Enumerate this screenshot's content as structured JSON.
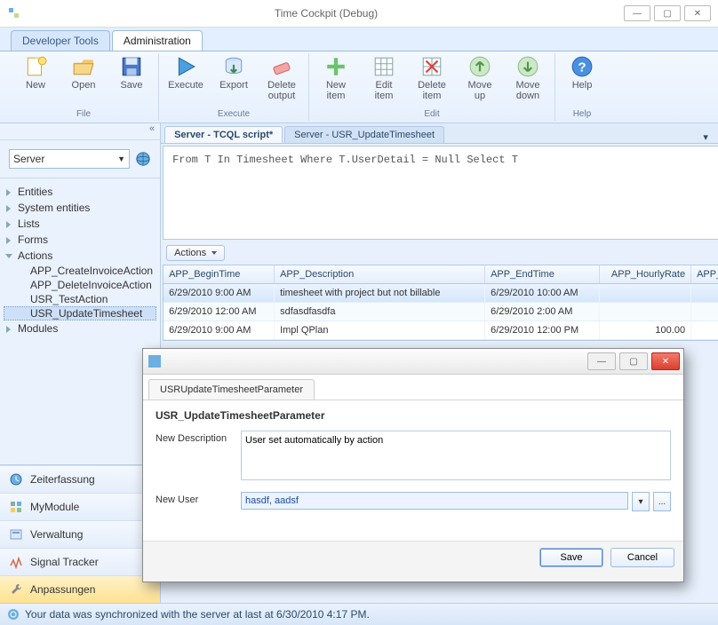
{
  "window": {
    "title": "Time Cockpit (Debug)"
  },
  "top_tabs": {
    "dev": "Developer Tools",
    "admin": "Administration"
  },
  "ribbon": {
    "file": {
      "label": "File",
      "new": "New",
      "open": "Open",
      "save": "Save"
    },
    "execute": {
      "label": "Execute",
      "execute": "Execute",
      "export": "Export",
      "delete_output": "Delete\noutput"
    },
    "edit": {
      "label": "Edit",
      "new_item": "New\nitem",
      "edit_item": "Edit\nitem",
      "delete_item": "Delete\nitem",
      "move_up": "Move\nup",
      "move_down": "Move\ndown"
    },
    "help": {
      "label": "Help",
      "help": "Help"
    }
  },
  "sidebar": {
    "collapse": "«",
    "dropdown": "Server",
    "tree": {
      "entities": "Entities",
      "system_entities": "System entities",
      "lists": "Lists",
      "forms": "Forms",
      "actions": "Actions",
      "actions_children": {
        "c0": "APP_CreateInvoiceAction",
        "c1": "APP_DeleteInvoiceAction",
        "c2": "USR_TestAction",
        "c3": "USR_UpdateTimesheet"
      },
      "modules": "Modules"
    },
    "nav": {
      "n0": "Zeiterfassung",
      "n1": "MyModule",
      "n2": "Verwaltung",
      "n3": "Signal Tracker",
      "n4": "Anpassungen"
    }
  },
  "doctabs": {
    "t0": "Server - TCQL script*",
    "t1": "Server - USR_UpdateTimesheet"
  },
  "editor": {
    "text": "From T In Timesheet Where T.UserDetail = Null Select T"
  },
  "actions_dropdown": "Actions",
  "grid": {
    "headers": {
      "h0": "APP_BeginTime",
      "h1": "APP_Description",
      "h2": "APP_EndTime",
      "h3": "APP_HourlyRate",
      "h4": "APP_H"
    },
    "rows": {
      "r0": {
        "c0": "6/29/2010 9:00 AM",
        "c1": "timesheet with project but not billable",
        "c2": "6/29/2010 10:00 AM",
        "c3": "",
        "c4": ""
      },
      "r1": {
        "c0": "6/29/2010 12:00 AM",
        "c1": "sdfasdfasdfa",
        "c2": "6/29/2010 2:00 AM",
        "c3": "",
        "c4": ""
      },
      "r2": {
        "c0": "6/29/2010 9:00 AM",
        "c1": "Impl QPlan",
        "c2": "6/29/2010 12:00 PM",
        "c3": "100.00",
        "c4": ""
      }
    }
  },
  "status": {
    "text": "Your data was synchronized with the server at last at 6/30/2010 4:17 PM."
  },
  "modal": {
    "tab": "USRUpdateTimesheetParameter",
    "heading": "USR_UpdateTimesheetParameter",
    "label_desc": "New Description",
    "value_desc": "User set automatically by action",
    "label_user": "New User",
    "value_user": "hasdf, aadsf",
    "save": "Save",
    "cancel": "Cancel",
    "ellipsis": "..."
  }
}
